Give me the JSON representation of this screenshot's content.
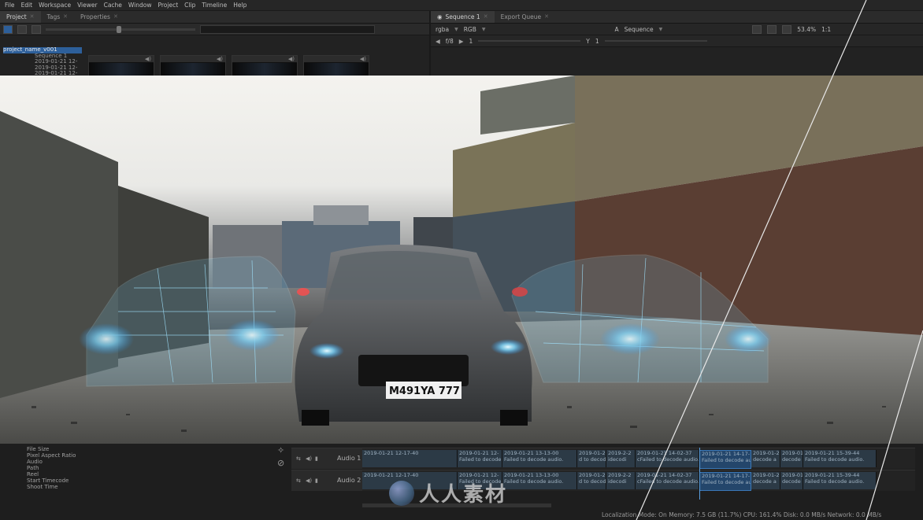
{
  "menu": [
    "File",
    "Edit",
    "Workspace",
    "Viewer",
    "Cache",
    "Window",
    "Project",
    "Clip",
    "Timeline",
    "Help"
  ],
  "left_tabs": [
    {
      "label": "Project"
    },
    {
      "label": "Tags"
    },
    {
      "label": "Properties"
    }
  ],
  "right_tabs": [
    {
      "label": "Sequence 1"
    },
    {
      "label": "Export Queue"
    }
  ],
  "project_tree": [
    "project_name_v001",
    "Sequence 1",
    "2019-01-21 12-",
    "2019-01-21 12-",
    "2019-01-21 12-"
  ],
  "viewer_controls": {
    "channels": "rgba",
    "colorspace": "RGB",
    "input": "A",
    "sequence": "Sequence",
    "zoom": "53.4%",
    "ratio": "1:1",
    "fstop": "f/8",
    "gain": "1",
    "gamma": "Y",
    "gamma_val": "1"
  },
  "properties": [
    "File Size",
    "Pixel Aspect Ratio",
    "Audio",
    "Path",
    "Reel",
    "Start Timecode",
    "Shoot Time"
  ],
  "tracks": [
    {
      "label": "Audio 1"
    },
    {
      "label": "Audio 2"
    }
  ],
  "clips": [
    {
      "time": "2019-01-21 12-17-40",
      "msg": ""
    },
    {
      "time": "2019-01-21 12-",
      "msg": "Failed to decode audio"
    },
    {
      "time": "2019-01-21 13-13-00",
      "msg": "Failed to decode audio."
    },
    {
      "time": "2019-01-2",
      "msg": "d to decode"
    },
    {
      "time": "2019-2-2",
      "msg": "idecodi"
    },
    {
      "time": "2019-01-21 14-02-37",
      "msg": "cFailed to decode audio."
    },
    {
      "time": "2019-01-21 14-17-",
      "msg": "Failed to decode audi"
    },
    {
      "time": "2019-01-2",
      "msg": "decode a"
    },
    {
      "time": "2019-01",
      "msg": "decode"
    },
    {
      "time": "2019-01-21 15-39-44",
      "msg": "Failed to decode audio."
    }
  ],
  "status": "Localization Mode: On  Memory: 7.5 GB (11.7%)  CPU: 161.4%  Disk: 0.0 MB/s  Network: 0.0 MB/s",
  "plate": "M491YA 777",
  "watermark": "人人素材"
}
